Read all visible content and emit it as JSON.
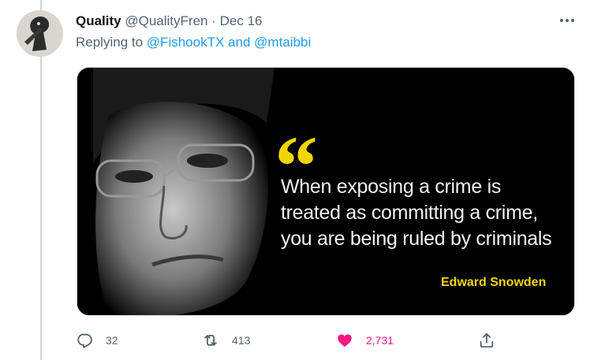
{
  "tweet": {
    "display_name": "Quality",
    "handle": "@QualityFren",
    "separator": "·",
    "date": "Dec 16",
    "replying_prefix": "Replying to",
    "replying_user_1": "@FishookTX",
    "replying_and": "and",
    "replying_user_2": "@mtaibbi"
  },
  "media": {
    "quote_mark": "“",
    "quote_line_1": "When exposing a crime is",
    "quote_line_2": "treated as committing a crime,",
    "quote_line_3": "you are being ruled by criminals",
    "author": "Edward Snowden",
    "accent_color": "#f2d500"
  },
  "actions": {
    "reply_count": "32",
    "retweet_count": "413",
    "like_count": "2,731",
    "like_color": "#f91880"
  },
  "icons": {
    "avatar": "avatar-image",
    "more": "more-icon",
    "reply": "reply-icon",
    "retweet": "retweet-icon",
    "like": "heart-icon",
    "share": "share-icon"
  }
}
